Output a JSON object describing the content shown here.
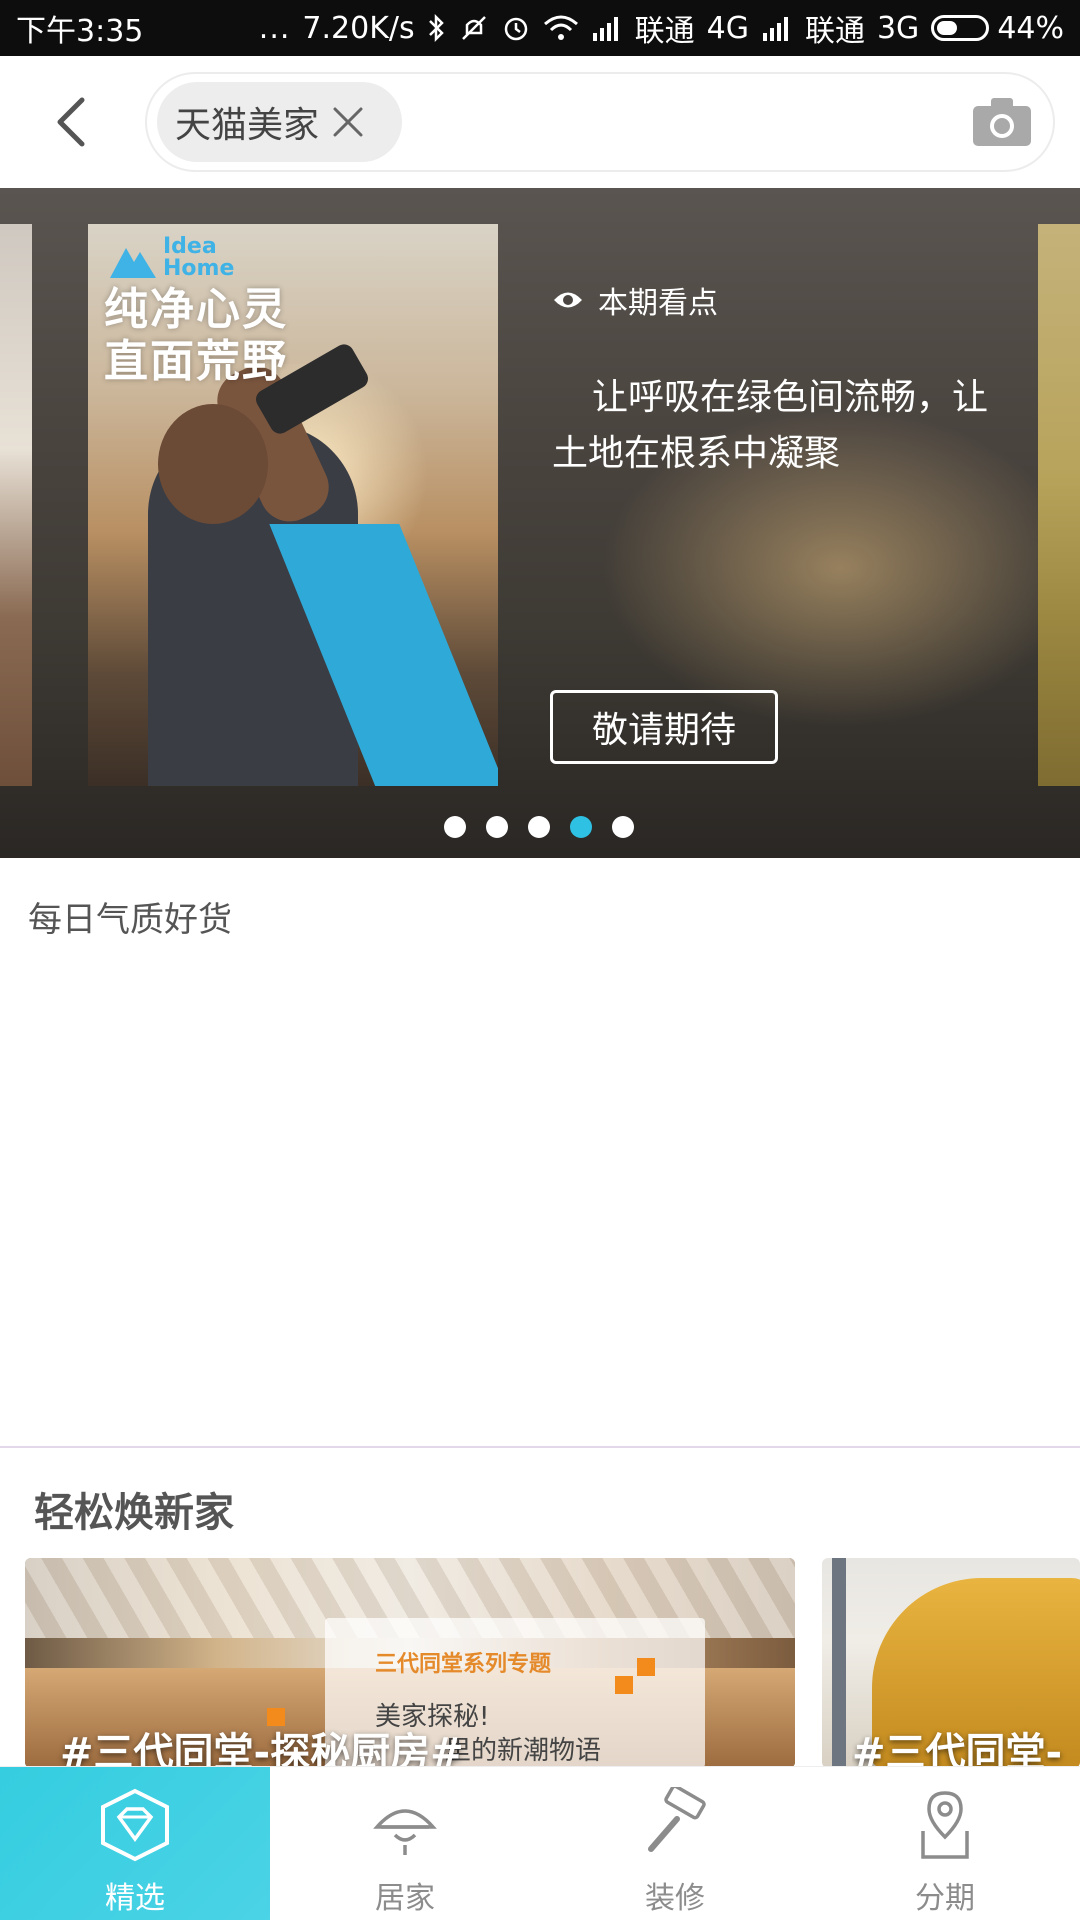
{
  "status_bar": {
    "time": "下午3:35",
    "dots": "...",
    "net_speed": "7.20K/s",
    "carrier1": "联通",
    "network1": "4G",
    "carrier2": "联通",
    "network2": "3G",
    "battery": "44%",
    "battery_level": 0.44
  },
  "search": {
    "back_icon": "chevron-left-icon",
    "chip_label": "天猫美家",
    "clear_icon": "close-icon",
    "camera_icon": "camera-icon"
  },
  "banner": {
    "poster_logo_line1": "Idea",
    "poster_logo_line2": "Home",
    "poster_slogan_line1": "纯净心灵",
    "poster_slogan_line2": "直面荒野",
    "highlight_label": "本期看点",
    "description": "让呼吸在绿色间流畅，让土地在根系中凝聚",
    "button_label": "敬请期待",
    "dots_count": 5,
    "active_dot": 4,
    "accent_color": "#2ec1e3"
  },
  "daily": {
    "title": "每日气质好货"
  },
  "renew": {
    "title": "轻松焕新家",
    "cards": [
      {
        "caption": "#三代同堂-探秘厨房#",
        "overlay_title": "三代同堂系列专题",
        "overlay_sub": "美家探秘!",
        "overlay_sub2": "里的新潮物语"
      },
      {
        "caption": "#三代同堂-"
      }
    ]
  },
  "bottom_nav": {
    "active_color": "#3ccfe2",
    "items": [
      {
        "label": "精选",
        "icon": "diamond-icon",
        "active": true
      },
      {
        "label": "居家",
        "icon": "ceiling-lamp-icon",
        "active": false
      },
      {
        "label": "装修",
        "icon": "paint-roller-icon",
        "active": false
      },
      {
        "label": "分期",
        "icon": "location-pin-icon",
        "active": false
      }
    ]
  }
}
